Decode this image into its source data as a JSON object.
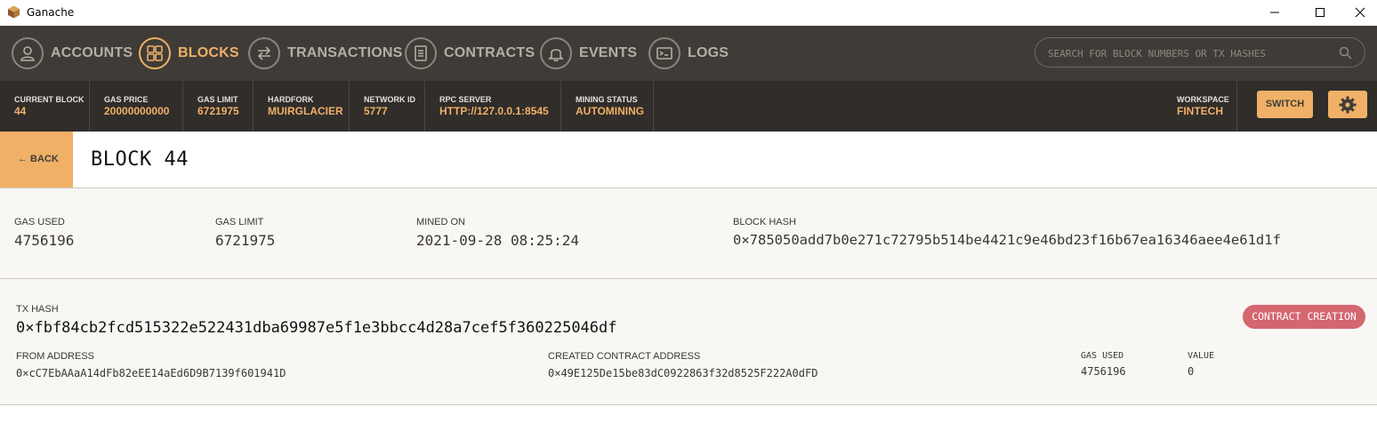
{
  "window": {
    "title": "Ganache",
    "controls": [
      "minimize-icon",
      "maximize-icon",
      "close-icon"
    ]
  },
  "nav": {
    "items": [
      {
        "label": "ACCOUNTS",
        "icon": "person-icon",
        "active": false
      },
      {
        "label": "BLOCKS",
        "icon": "blocks-icon",
        "active": true
      },
      {
        "label": "TRANSACTIONS",
        "icon": "swap-arrows-icon",
        "active": false
      },
      {
        "label": "CONTRACTS",
        "icon": "document-icon",
        "active": false
      },
      {
        "label": "EVENTS",
        "icon": "bell-icon",
        "active": false
      },
      {
        "label": "LOGS",
        "icon": "terminal-icon",
        "active": false
      }
    ],
    "search_placeholder": "SEARCH FOR BLOCK NUMBERS OR TX HASHES"
  },
  "status": {
    "current_block": {
      "label": "CURRENT BLOCK",
      "value": "44"
    },
    "gas_price": {
      "label": "GAS PRICE",
      "value": "20000000000"
    },
    "gas_limit": {
      "label": "GAS LIMIT",
      "value": "6721975"
    },
    "hardfork": {
      "label": "HARDFORK",
      "value": "MUIRGLACIER"
    },
    "network_id": {
      "label": "NETWORK ID",
      "value": "5777"
    },
    "rpc_server": {
      "label": "RPC SERVER",
      "value": "HTTP://127.0.0.1:8545"
    },
    "mining_status": {
      "label": "MINING STATUS",
      "value": "AUTOMINING"
    },
    "workspace": {
      "label": "WORKSPACE",
      "value": "FINTECH"
    },
    "switch_label": "SWITCH"
  },
  "block": {
    "back_label": "← BACK",
    "title": "BLOCK 44",
    "gas_used": {
      "label": "GAS USED",
      "value": "4756196"
    },
    "gas_limit": {
      "label": "GAS LIMIT",
      "value": "6721975"
    },
    "mined_on": {
      "label": "MINED ON",
      "value": "2021-09-28 08:25:24"
    },
    "block_hash": {
      "label": "BLOCK HASH",
      "value": "0×785050add7b0e271c72795b514be4421c9e46bd23f16b67ea16346aee4e61d1f"
    }
  },
  "transaction": {
    "tx_hash_label": "TX HASH",
    "tx_hash": "0×fbf84cb2fcd515322e522431dba69987e5f1e3bbcc4d28a7cef5f360225046df",
    "badge": "CONTRACT CREATION",
    "from_label": "FROM ADDRESS",
    "from": "0×cC7EbAAaA14dFb82eEE14aEd6D9B7139f601941D",
    "created_label": "CREATED CONTRACT ADDRESS",
    "created": "0×49E125De15be83dC0922863f32d8525F222A0dFD",
    "gas_used_label": "GAS USED",
    "gas_used": "4756196",
    "value_label": "VALUE",
    "value": "0"
  },
  "colors": {
    "accent": "#f0b067",
    "nav_bg": "#3f3c38",
    "status_bg": "#302d2a",
    "badge": "#d46670"
  }
}
